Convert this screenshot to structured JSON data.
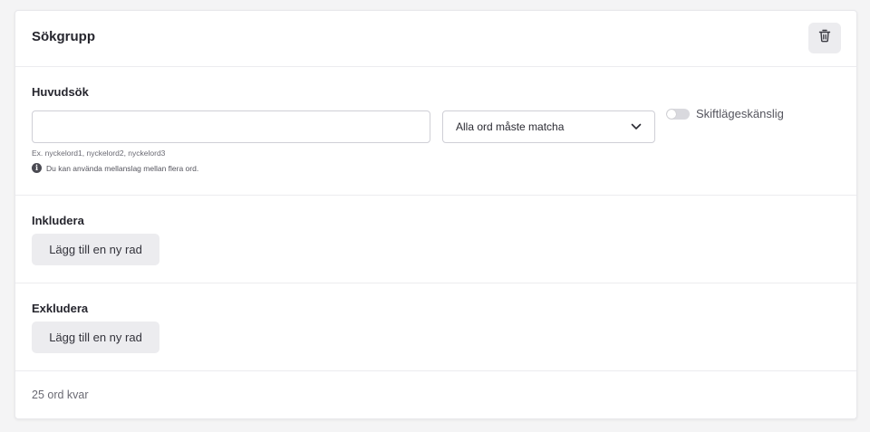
{
  "card": {
    "title": "Sökgrupp",
    "delete_icon": "trash-icon"
  },
  "main_search": {
    "label": "Huvudsök",
    "input_value": "",
    "input_placeholder": "",
    "match_select": {
      "selected": "Alla ord måste matcha",
      "icon": "chevron-down-icon"
    },
    "case_toggle": {
      "label": "Skiftlägeskänslig",
      "on": false
    },
    "helper_text": "Ex. nyckelord1, nyckelord2, nyckelord3",
    "info_text": "Du kan använda mellanslag mellan flera ord.",
    "info_icon_glyph": "i"
  },
  "include": {
    "label": "Inkludera",
    "add_row_label": "Lägg till en ny rad"
  },
  "exclude": {
    "label": "Exkludera",
    "add_row_label": "Lägg till en ny rad"
  },
  "footer": {
    "words_left": "25 ord kvar"
  }
}
